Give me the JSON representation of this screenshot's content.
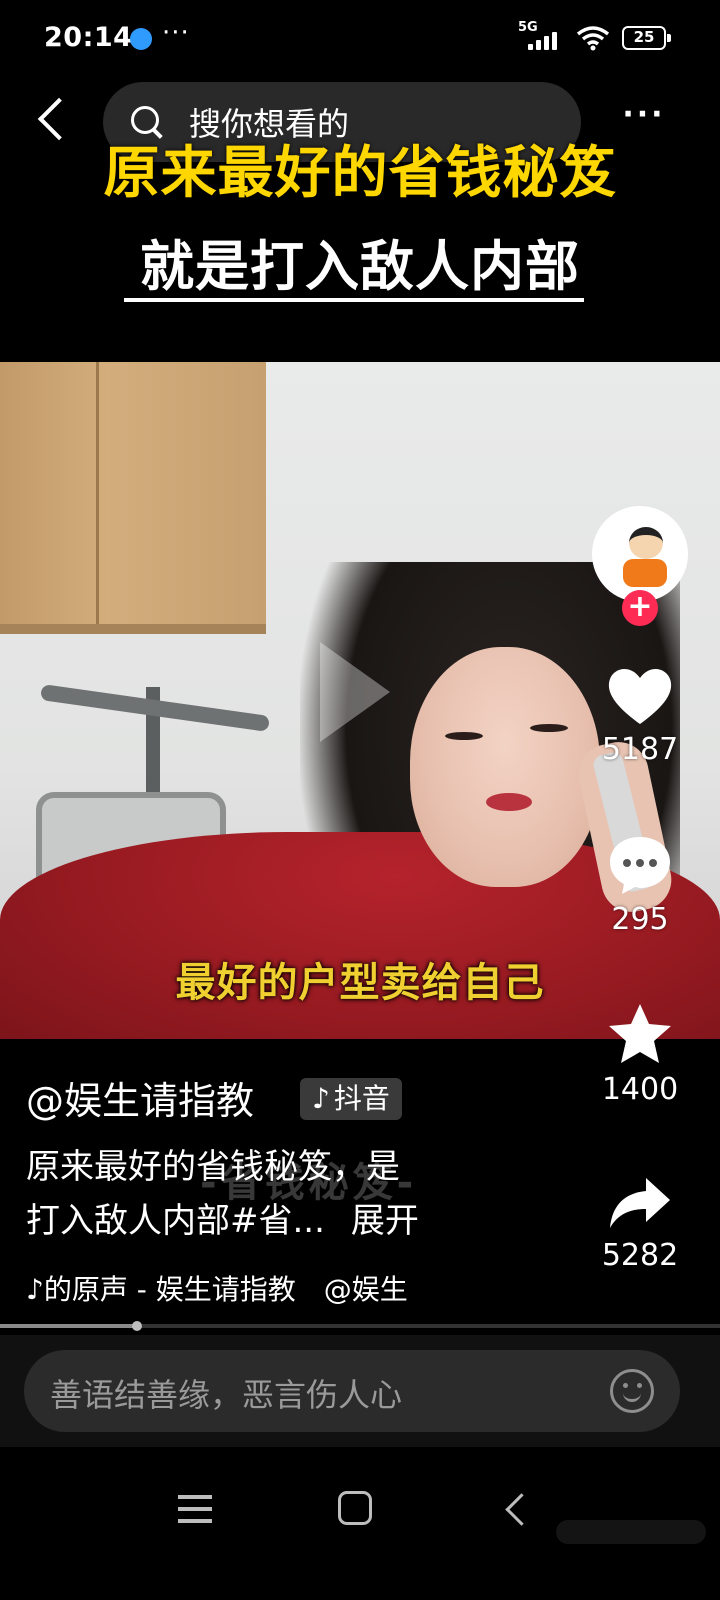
{
  "status_bar": {
    "time": "20:14",
    "more": "···",
    "network": "5G",
    "battery": "25",
    "app_icon": "blue-dot-icon"
  },
  "top_nav": {
    "search_placeholder": "搜你想看的",
    "more_label": "···",
    "back_icon": "chevron-left-icon",
    "search_icon": "search-icon"
  },
  "video": {
    "title_line1": "原来最好的省钱秘笈",
    "title_line2": "就是打入敌人内部",
    "caption": "最好的户型卖给自己",
    "title_color": "#ffd700",
    "caption_color": "#f0cf30",
    "progress_fraction": 0.19
  },
  "side_actions": {
    "follow_label": "+",
    "like_count": "5187",
    "comment_count": "295",
    "favorite_count": "1400",
    "share_count": "5282",
    "follow_color": "#fe2c55"
  },
  "info": {
    "author": "@娱生请指教",
    "platform_note": "♪",
    "platform": "抖音",
    "description_line1": "原来最好的省钱秘笈，是",
    "description_line2": "打入敌人内部#省...",
    "expand_label": "展开",
    "overlay_text": "-省钱秘笈-",
    "music_note": "♪",
    "music": "的原声 - 娱生请指教　@娱生"
  },
  "comment_bar": {
    "placeholder": "善语结善缘，恶言伤人心",
    "emoji_icon": "emoji-smile-icon"
  },
  "nav_bar": {
    "menu_icon": "menu-icon",
    "home_icon": "home-icon",
    "back_icon": "back-icon"
  }
}
